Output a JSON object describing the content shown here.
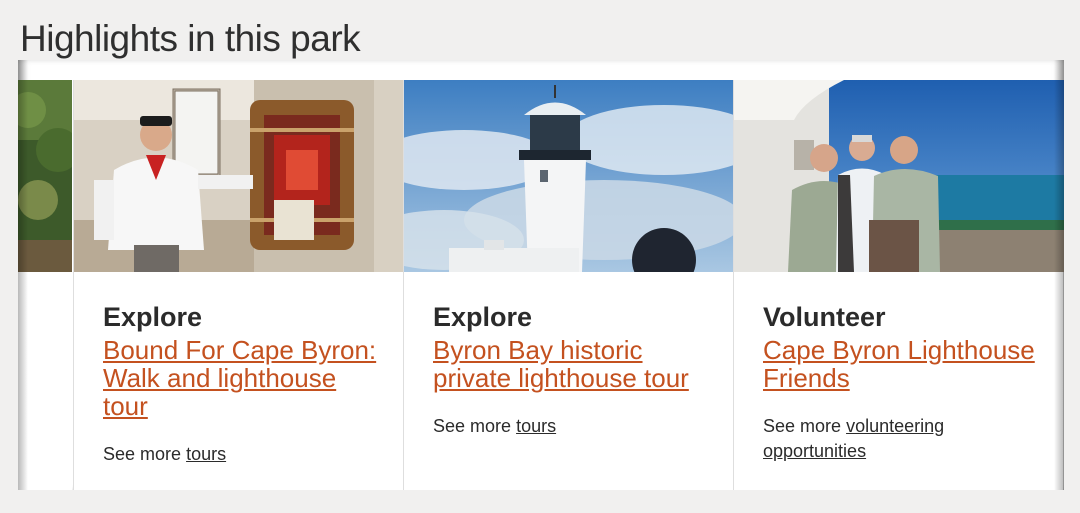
{
  "section": {
    "title": "Highlights in this park"
  },
  "cards": [
    {
      "category": "Explore",
      "link": "Bound For Cape Byron: Walk and lighthouse tour",
      "see_more_prefix": "See more",
      "see_more_link": "tours"
    },
    {
      "category": "Explore",
      "link": "Byron Bay historic private lighthouse tour",
      "see_more_prefix": "See more",
      "see_more_link": "tours"
    },
    {
      "category": "Volunteer",
      "link": "Cape Byron Lighthouse Friends",
      "see_more_prefix": "See more",
      "see_more_link": "volunteering opportunities"
    }
  ],
  "colors": {
    "background": "#f1f0ef",
    "link": "#c4511f",
    "text": "#2b2b2b"
  }
}
